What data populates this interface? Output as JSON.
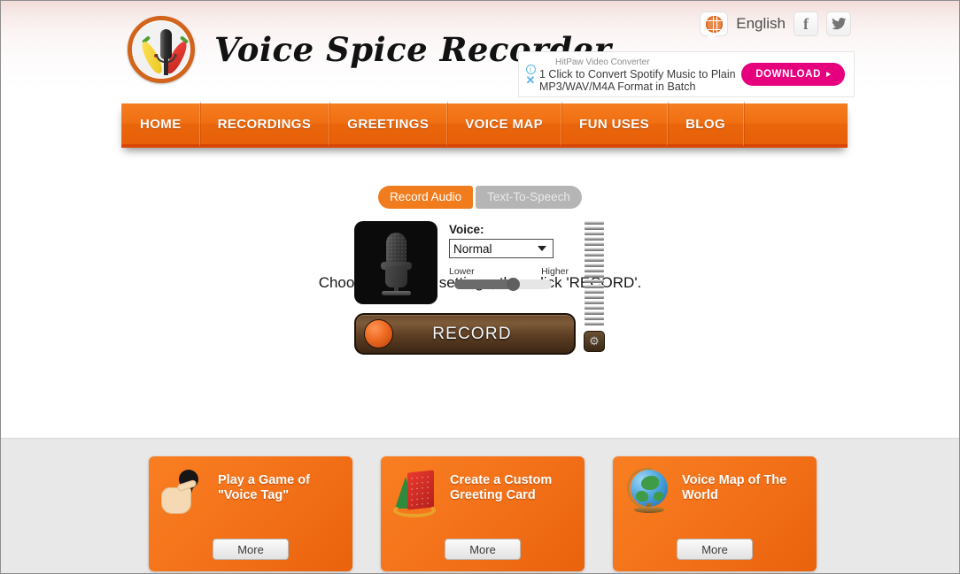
{
  "header": {
    "logo_text": "Voice Spice Recorder",
    "language": "English",
    "globe_icon": "globe-icon",
    "facebook_icon": "facebook-icon",
    "twitter_icon": "twitter-icon"
  },
  "ad": {
    "title": "HitPaw Video Converter",
    "line1": "1 Click to Convert Spotify Music to Plain",
    "line2": "MP3/WAV/M4A Format in Batch",
    "button": "DOWNLOAD",
    "info_icon": "info-icon",
    "close_icon": "close-icon",
    "button_color": "#e6007e"
  },
  "nav": {
    "items": [
      {
        "label": "HOME"
      },
      {
        "label": "RECORDINGS"
      },
      {
        "label": "GREETINGS"
      },
      {
        "label": "VOICE MAP"
      },
      {
        "label": "FUN USES"
      },
      {
        "label": "BLOG"
      }
    ],
    "accent_color": "#f07c1d"
  },
  "recorder": {
    "mode_tabs": [
      {
        "label": "Record Audio",
        "active": true
      },
      {
        "label": "Text-To-Speech",
        "active": false
      }
    ],
    "voice_label": "Voice:",
    "voice_value": "Normal",
    "voice_options": [
      "Normal"
    ],
    "pitch_low_label": "Lower",
    "pitch_high_label": "Higher",
    "pitch_percent": 60,
    "record_button": "RECORD",
    "instruction": "Choose the voice settings, then click 'RECORD'.",
    "mic_icon": "microphone-icon",
    "settings_icon": "gear-icon",
    "vu_meter_bars": 20
  },
  "promos": {
    "more_label": "More",
    "cards": [
      {
        "title": "Play a Game of \"Voice Tag\"",
        "icon": "hand-microphone-icon"
      },
      {
        "title": "Create a Custom Greeting Card",
        "icon": "greeting-card-icon"
      },
      {
        "title": "Voice Map of The World",
        "icon": "globe-icon"
      }
    ]
  }
}
